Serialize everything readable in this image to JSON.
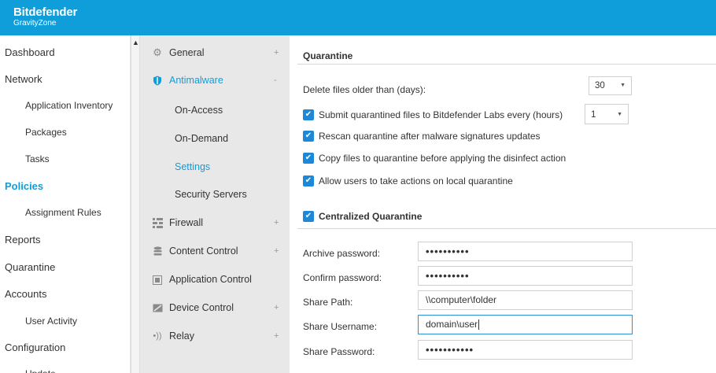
{
  "brand": {
    "name": "Bitdefender",
    "product": "GravityZone",
    "color": "#0f9ed9"
  },
  "leftnav": [
    {
      "label": "Dashboard",
      "level": "top",
      "active": false
    },
    {
      "label": "Network",
      "level": "top",
      "active": false
    },
    {
      "label": "Application Inventory",
      "level": "sub",
      "active": false
    },
    {
      "label": "Packages",
      "level": "sub",
      "active": false
    },
    {
      "label": "Tasks",
      "level": "sub",
      "active": false
    },
    {
      "label": "Policies",
      "level": "top",
      "active": true
    },
    {
      "label": "Assignment Rules",
      "level": "sub",
      "active": false
    },
    {
      "label": "Reports",
      "level": "top",
      "active": false
    },
    {
      "label": "Quarantine",
      "level": "top",
      "active": false
    },
    {
      "label": "Accounts",
      "level": "top",
      "active": false
    },
    {
      "label": "User Activity",
      "level": "sub",
      "active": false
    },
    {
      "label": "Configuration",
      "level": "top",
      "active": false
    },
    {
      "label": "Update",
      "level": "sub",
      "active": false
    }
  ],
  "midnav": [
    {
      "label": "General",
      "icon": "gear-icon",
      "toggle": "+",
      "sub": false,
      "active": false
    },
    {
      "label": "Antimalware",
      "icon": "shield-icon",
      "toggle": "-",
      "sub": false,
      "active": true
    },
    {
      "label": "On-Access",
      "icon": "",
      "toggle": "",
      "sub": true,
      "active": false
    },
    {
      "label": "On-Demand",
      "icon": "",
      "toggle": "",
      "sub": true,
      "active": false
    },
    {
      "label": "Settings",
      "icon": "",
      "toggle": "",
      "sub": true,
      "active": true
    },
    {
      "label": "Security Servers",
      "icon": "",
      "toggle": "",
      "sub": true,
      "active": false
    },
    {
      "label": "Firewall",
      "icon": "firewall-icon",
      "toggle": "+",
      "sub": false,
      "active": false
    },
    {
      "label": "Content Control",
      "icon": "database-icon",
      "toggle": "+",
      "sub": false,
      "active": false
    },
    {
      "label": "Application Control",
      "icon": "app-control-icon",
      "toggle": "",
      "sub": false,
      "active": false
    },
    {
      "label": "Device Control",
      "icon": "device-icon",
      "toggle": "+",
      "sub": false,
      "active": false
    },
    {
      "label": "Relay",
      "icon": "relay-icon",
      "toggle": "+",
      "sub": false,
      "active": false
    }
  ],
  "quarantine": {
    "title": "Quarantine",
    "delete_label": "Delete files older than (days):",
    "delete_value": "30",
    "options": [
      {
        "label": "Submit quarantined files to Bitdefender Labs every (hours)",
        "checked": true,
        "select_value": "1"
      },
      {
        "label": "Rescan quarantine after malware signatures updates",
        "checked": true
      },
      {
        "label": "Copy files to quarantine before applying the disinfect action",
        "checked": true
      },
      {
        "label": "Allow users to take actions on local quarantine",
        "checked": true
      }
    ]
  },
  "centralized": {
    "title": "Centralized Quarantine",
    "checked": true,
    "fields": [
      {
        "label": "Archive password:",
        "value": "••••••••••",
        "type": "password"
      },
      {
        "label": "Confirm password:",
        "value": "••••••••••",
        "type": "password"
      },
      {
        "label": "Share Path:",
        "value": "\\\\computer\\folder",
        "type": "text"
      },
      {
        "label": "Share Username:",
        "value": "domain\\user",
        "type": "text",
        "focused": true
      },
      {
        "label": "Share Password:",
        "value": "•••••••••••",
        "type": "password"
      }
    ]
  }
}
